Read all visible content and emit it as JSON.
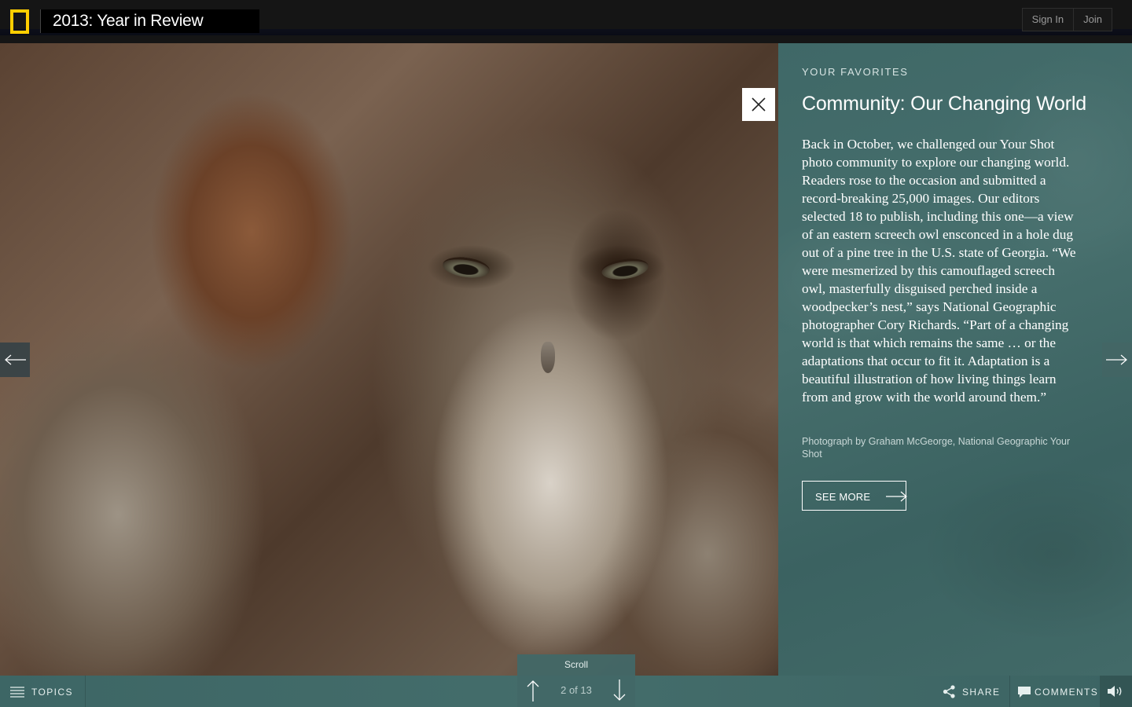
{
  "header": {
    "logo_icon": "nat-geo-yellow-border-icon",
    "title": "2013: Year in Review",
    "sign_in": "Sign In",
    "join": "Join"
  },
  "photo": {
    "alt": "eastern screech owl camouflaged in pine tree hole",
    "close_icon": "close-icon"
  },
  "story": {
    "section": "YOUR FAVORITES",
    "title": "Community: Our Changing World",
    "body": "Back in October, we challenged our Your Shot photo community to explore our changing world. Readers rose to the occasion and submitted a record-breaking 25,000 images. Our editors selected 18 to publish, including this one—a view of an eastern screech owl ensconced in a hole dug out of a pine tree in the U.S. state of Georgia. “We were mesmerized by this camouflaged screech owl, masterfully disguised perched inside a woodpecker’s nest,” says National Geographic photographer Cory Richards. “Part of a changing world is that which remains the same … or the adaptations that occur to fit it. Adaptation is a beautiful illustration of how living things learn from and grow with the world around them.”",
    "credit": "Photograph by Graham McGeorge, National Geographic Your Shot",
    "see_more": "SEE MORE"
  },
  "navigation": {
    "prev_icon": "arrow-left-icon",
    "next_icon": "arrow-right-icon",
    "scroll_label": "Scroll",
    "page_count": "2 of 13"
  },
  "footer": {
    "topics": "TOPICS",
    "share": "SHARE",
    "comments": "COMMENTS",
    "sound_icon": "speaker-icon"
  },
  "colors": {
    "logo_yellow": "#ffce00",
    "panel_teal": "#446d6b",
    "header_bg": "#151515"
  }
}
